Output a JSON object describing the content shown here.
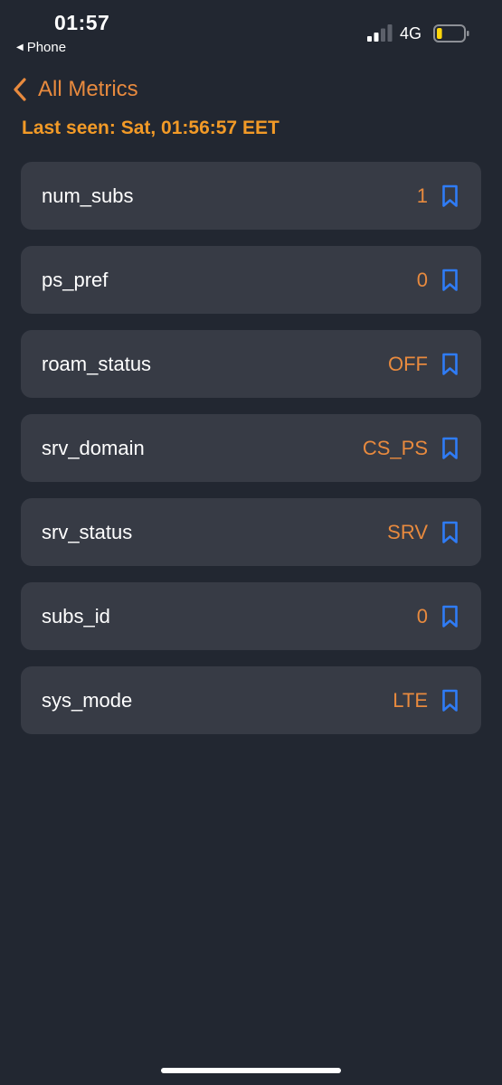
{
  "status_bar": {
    "time": "01:57",
    "back_app_label": "Phone",
    "network_type": "4G",
    "signal_bars_active": 2,
    "signal_bars_total": 4,
    "battery_level": 0.2,
    "battery_color": "#ffd60a"
  },
  "nav": {
    "back_label": "All Metrics"
  },
  "last_seen": "Last seen: Sat, 01:56:57 EET",
  "metrics": [
    {
      "name": "num_subs",
      "value": "1"
    },
    {
      "name": "ps_pref",
      "value": "0"
    },
    {
      "name": "roam_status",
      "value": "OFF"
    },
    {
      "name": "srv_domain",
      "value": "CS_PS"
    },
    {
      "name": "srv_status",
      "value": "SRV"
    },
    {
      "name": "subs_id",
      "value": "0"
    },
    {
      "name": "sys_mode",
      "value": "LTE"
    }
  ],
  "colors": {
    "background": "#222731",
    "card": "#373b45",
    "accent_orange": "#e88a3e",
    "last_seen_orange": "#f29a27",
    "bookmark_blue": "#2f7cf6"
  },
  "icons": {
    "back": "chevron-left-icon",
    "bookmark": "bookmark-icon"
  }
}
